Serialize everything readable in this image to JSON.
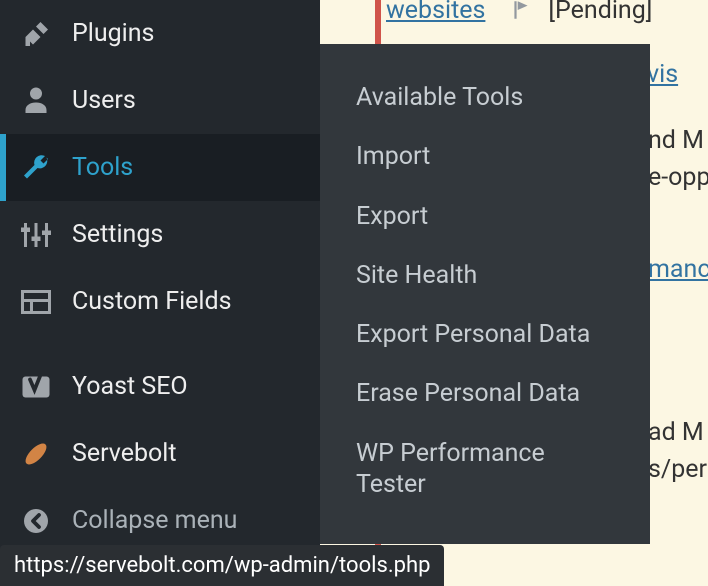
{
  "sidebar": {
    "items": [
      {
        "label": "Plugins"
      },
      {
        "label": "Users"
      },
      {
        "label": "Tools"
      },
      {
        "label": "Settings"
      },
      {
        "label": "Custom Fields"
      },
      {
        "label": "Yoast SEO"
      },
      {
        "label": "Servebolt"
      },
      {
        "label": "Collapse menu"
      }
    ]
  },
  "submenu": {
    "items": [
      "Available Tools",
      "Import",
      "Export",
      "Site Health",
      "Export Personal Data",
      "Erase Personal Data",
      "WP Performance Tester"
    ]
  },
  "content": {
    "link_websites": "websites",
    "pending_label": "[Pending]",
    "link_vis": "vis",
    "frag_nd_m": "nd M",
    "frag_e_opp": "e-opp",
    "link_mance": "mance",
    "frag_ad_m": "ad M",
    "frag_s_per": "s/per",
    "frag_ellipsis": "[...]"
  },
  "status_bar": {
    "url": "https://servebolt.com/wp-admin/tools.php"
  }
}
